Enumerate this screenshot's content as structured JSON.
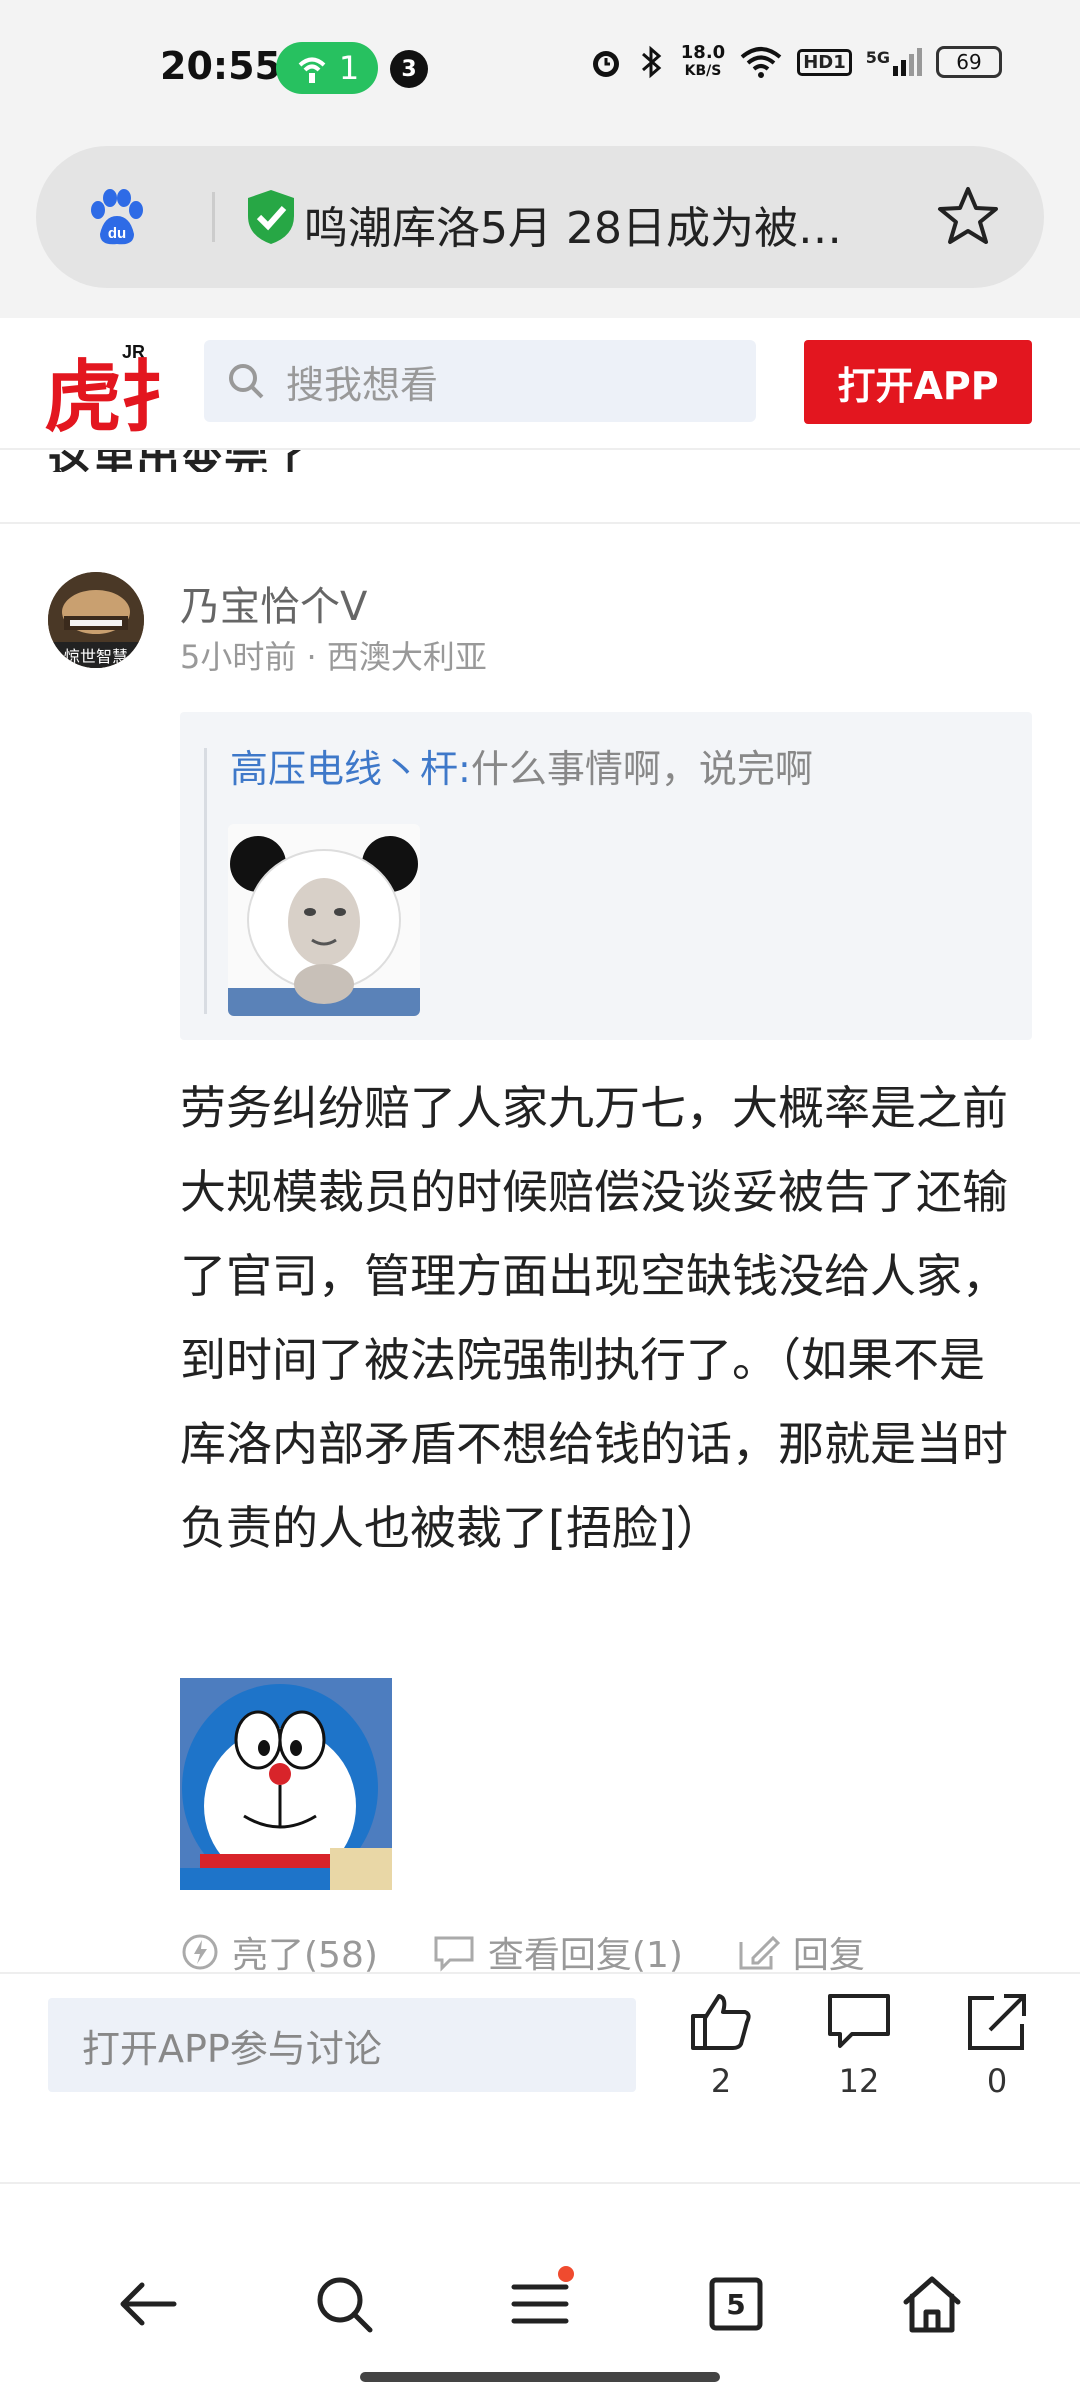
{
  "status_bar": {
    "time": "20:55",
    "hotspot_count": "1",
    "notification_count": "3",
    "net_speed_value": "18.0",
    "net_speed_unit": "KB/S",
    "hd_label": "HD1",
    "network_label": "5G",
    "battery": "69"
  },
  "browser": {
    "url_title": "鸣潮库洛5月 28日成为被…",
    "icons": [
      "baidu-icon",
      "shield-check-icon",
      "star-icon"
    ]
  },
  "header": {
    "search_placeholder": "搜我想看",
    "open_app_label": "打开APP"
  },
  "cut_text": "这里出变完了",
  "comment": {
    "username": "乃宝恰个V",
    "avatar_caption": "惊世智慧",
    "meta": "5小时前 · 西澳大利亚",
    "quote_user": "高压电线丶杆:",
    "quote_text": "什么事情啊，说完啊",
    "body": "劳务纠纷赔了人家九万七，大概率是之前大规模裁员的时候赔偿没谈妥被告了还输了官司，管理方面出现空缺钱没给人家，到时间了被法院强制执行了。（如果不是库洛内部矛盾不想给钱的话，那就是当时负责的人也被裁了[捂脸]）",
    "like_label": "亮了(58)",
    "view_replies_label": "查看回复(1)",
    "reply_label": "回复"
  },
  "bottom_bar": {
    "discuss_placeholder": "打开APP参与讨论",
    "like_count": "2",
    "comment_count": "12",
    "share_count": "0"
  },
  "navbar": {
    "tabs_count": "5"
  },
  "colors": {
    "accent_red": "#e3161f",
    "link_blue": "#3e78c9",
    "hotspot_green": "#27c160"
  }
}
